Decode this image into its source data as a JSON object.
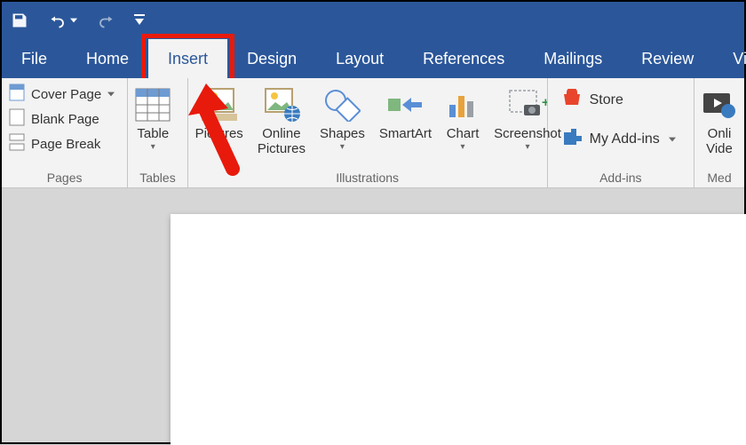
{
  "quick_access": {
    "save": "save-icon",
    "undo": "undo-icon",
    "redo": "redo-icon",
    "customize": "customize-icon"
  },
  "tabs": {
    "file": "File",
    "home": "Home",
    "insert": "Insert",
    "design": "Design",
    "layout": "Layout",
    "references": "References",
    "mailings": "Mailings",
    "review": "Review",
    "view": "View"
  },
  "ribbon": {
    "pages": {
      "label": "Pages",
      "cover_page": "Cover Page",
      "blank_page": "Blank Page",
      "page_break": "Page Break"
    },
    "tables": {
      "label": "Tables",
      "table": "Table"
    },
    "illustrations": {
      "label": "Illustrations",
      "pictures": "Pictures",
      "online_pictures_l1": "Online",
      "online_pictures_l2": "Pictures",
      "shapes": "Shapes",
      "smartart": "SmartArt",
      "chart": "Chart",
      "screenshot": "Screenshot"
    },
    "addins": {
      "label": "Add-ins",
      "store": "Store",
      "my_addins": "My Add-ins"
    },
    "media": {
      "label": "Med",
      "online_video_l1": "Onli",
      "online_video_l2": "Vide"
    }
  },
  "colors": {
    "brand": "#2b579a",
    "highlight": "#e81a0c"
  }
}
